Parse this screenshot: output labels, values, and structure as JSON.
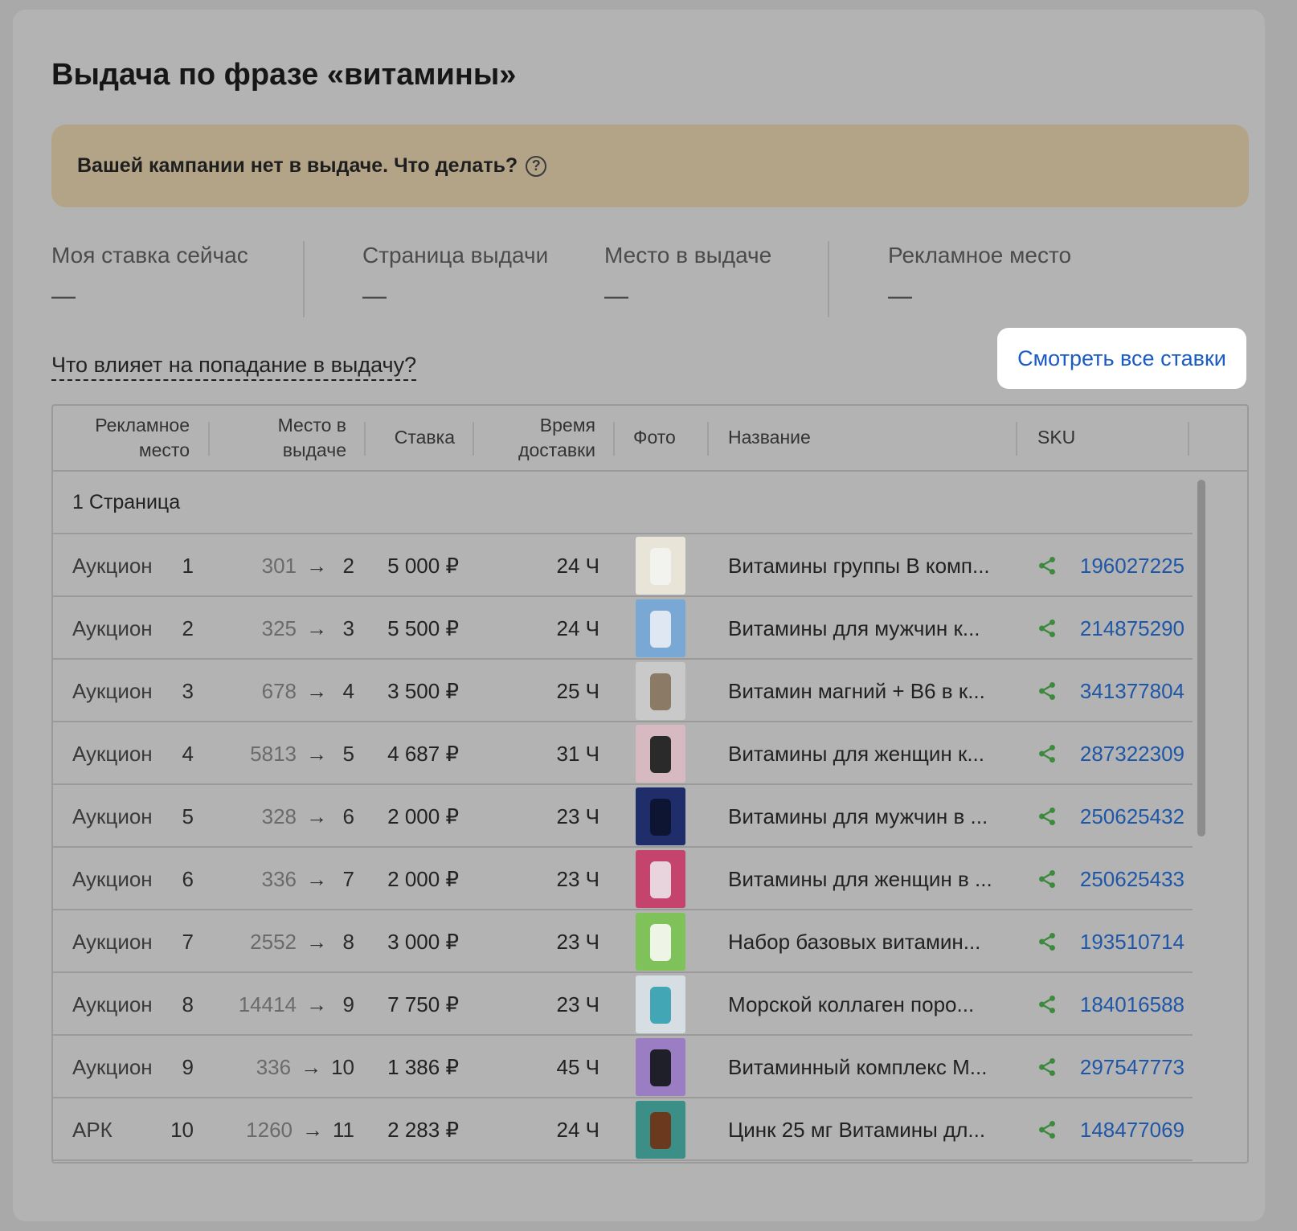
{
  "title": "Выдача по фразе «витамины»",
  "alert": {
    "text": "Вашей кампании нет в выдаче. Что делать?",
    "help_icon": "question-circle-icon"
  },
  "stats": [
    {
      "label": "Моя ставка сейчас",
      "value": "—"
    },
    {
      "label": "Страница выдачи",
      "value": "—"
    },
    {
      "label": "Место в выдаче",
      "value": "—"
    },
    {
      "label": "Рекламное место",
      "value": "—"
    }
  ],
  "info_link": "Что влияет на попадание в выдачу?",
  "all_bids_link": "Смотреть все ставки",
  "table": {
    "headers": {
      "ad_place_1": "Рекламное",
      "ad_place_2": "место",
      "position_1": "Место в",
      "position_2": "выдаче",
      "bid": "Ставка",
      "delivery_1": "Время",
      "delivery_2": "доставки",
      "photo": "Фото",
      "name": "Название",
      "sku": "SKU"
    },
    "section_label": "1 Страница",
    "rows": [
      {
        "type": "Аукцион",
        "place": "1",
        "from": "301",
        "to": "2",
        "bid": "5 000 ₽",
        "time": "24 Ч",
        "name": "Витамины группы В комп...",
        "sku": "196027225",
        "photo_bg": "#e9e4d8",
        "photo_fg": "#f2f2ef"
      },
      {
        "type": "Аукцион",
        "place": "2",
        "from": "325",
        "to": "3",
        "bid": "5 500 ₽",
        "time": "24 Ч",
        "name": "Витамины для мужчин к...",
        "sku": "214875290",
        "photo_bg": "#7aa8d4",
        "photo_fg": "#dfe8f2"
      },
      {
        "type": "Аукцион",
        "place": "3",
        "from": "678",
        "to": "4",
        "bid": "3 500 ₽",
        "time": "25 Ч",
        "name": "Витамин магний + B6 в к...",
        "sku": "341377804",
        "photo_bg": "#c9c9c9",
        "photo_fg": "#8a7a66"
      },
      {
        "type": "Аукцион",
        "place": "4",
        "from": "5813",
        "to": "5",
        "bid": "4 687 ₽",
        "time": "31 Ч",
        "name": "Витамины для женщин к...",
        "sku": "287322309",
        "photo_bg": "#d7b9c2",
        "photo_fg": "#2a2a2a"
      },
      {
        "type": "Аукцион",
        "place": "5",
        "from": "328",
        "to": "6",
        "bid": "2 000 ₽",
        "time": "23 Ч",
        "name": "Витамины для мужчин в ...",
        "sku": "250625432",
        "photo_bg": "#1f2e6b",
        "photo_fg": "#0e1533"
      },
      {
        "type": "Аукцион",
        "place": "6",
        "from": "336",
        "to": "7",
        "bid": "2 000 ₽",
        "time": "23 Ч",
        "name": "Витамины для женщин в ...",
        "sku": "250625433",
        "photo_bg": "#c4446d",
        "photo_fg": "#e8d4dc"
      },
      {
        "type": "Аукцион",
        "place": "7",
        "from": "2552",
        "to": "8",
        "bid": "3 000 ₽",
        "time": "23 Ч",
        "name": "Набор базовых витамин...",
        "sku": "193510714",
        "photo_bg": "#7fc25a",
        "photo_fg": "#eef5e6"
      },
      {
        "type": "Аукцион",
        "place": "8",
        "from": "14414",
        "to": "9",
        "bid": "7 750 ₽",
        "time": "23 Ч",
        "name": "Морской коллаген поро...",
        "sku": "184016588",
        "photo_bg": "#d6dde3",
        "photo_fg": "#43a6b4"
      },
      {
        "type": "Аукцион",
        "place": "9",
        "from": "336",
        "to": "10",
        "bid": "1 386 ₽",
        "time": "45 Ч",
        "name": "Витаминный комплекс M...",
        "sku": "297547773",
        "photo_bg": "#9b7dc4",
        "photo_fg": "#1f1f2a"
      },
      {
        "type": "АРК",
        "place": "10",
        "from": "1260",
        "to": "11",
        "bid": "2 283 ₽",
        "time": "24 Ч",
        "name": "Цинк 25 мг Витамины дл...",
        "sku": "148477069",
        "photo_bg": "#3b8f86",
        "photo_fg": "#6b3a1e"
      }
    ]
  }
}
